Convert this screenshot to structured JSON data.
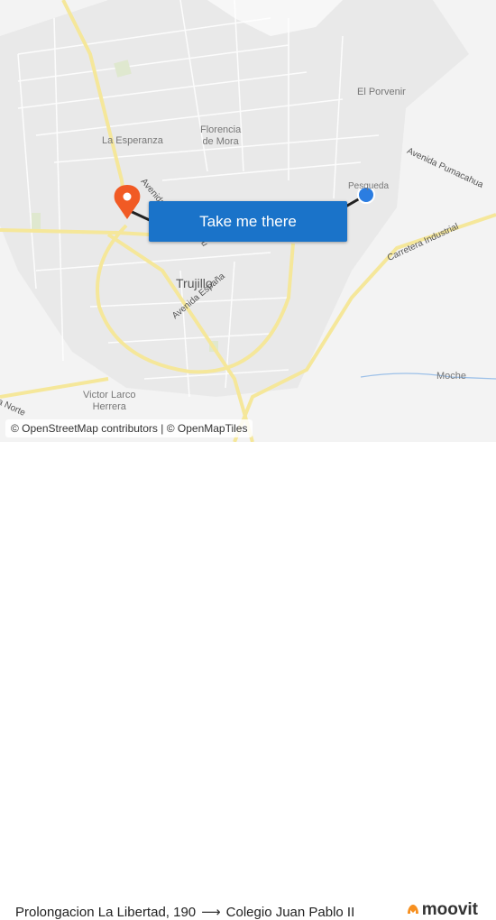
{
  "map": {
    "places": {
      "porvenir": "El Porvenir",
      "esperanza": "La Esperanza",
      "florencia": "Florencia\nde Mora",
      "pesqueda": "Pesqueda",
      "trujillo": "Trujillo",
      "victor": "Victor Larco\nHerrera",
      "moche": "Moche"
    },
    "roads": {
      "pumacahua": "Avenida Pumacahua",
      "industrial": "Carretera Industrial",
      "espana": "Avenida España",
      "avenida_a": "Avenida",
      "avenida_b": "ru",
      "norte": "a Norte"
    },
    "cta_label": "Take me there",
    "attribution": "© OpenStreetMap contributors | © OpenMapTiles",
    "colors": {
      "route": "#222222",
      "origin": "#f15a24",
      "destination": "#2b7de1",
      "cta": "#1a73c9"
    }
  },
  "footer": {
    "origin": "Prolongacion La Libertad, 190",
    "destination": "Colegio Juan Pablo II",
    "brand_name": "moovit",
    "arrow": "⟶"
  }
}
